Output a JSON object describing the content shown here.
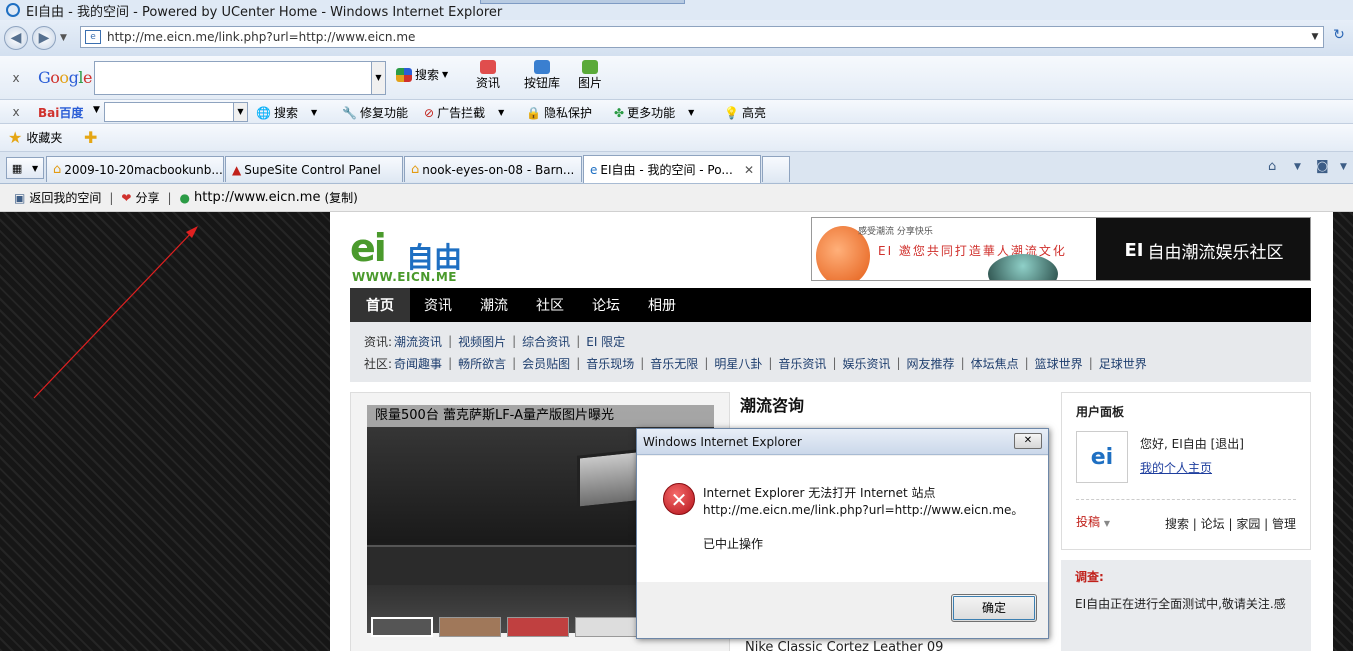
{
  "window": {
    "title": "EI自由 - 我的空间 - Powered by UCenter Home - Windows Internet Explorer"
  },
  "address_bar": {
    "url": "http://me.eicn.me/link.php?url=http://www.eicn.me"
  },
  "google_toolbar": {
    "logo": "Google",
    "search_label": "搜索",
    "news_label": "资讯",
    "buttons_label": "按钮库",
    "images_label": "图片"
  },
  "baidu_toolbar": {
    "logo_bai": "Bai",
    "logo_du": "百度",
    "search_label": "搜索",
    "repair_label": "修复功能",
    "adblock_label": "广告拦截",
    "privacy_label": "隐私保护",
    "more_label": "更多功能",
    "highlight_label": "高亮"
  },
  "favorites_bar": {
    "favorites_label": "收藏夹"
  },
  "tabs": [
    {
      "label": "2009-10-20macbookunb..."
    },
    {
      "label": "SupeSite Control Panel"
    },
    {
      "label": "nook-eyes-on-08 - Barn..."
    },
    {
      "label": "EI自由 - 我的空间 - Po..."
    }
  ],
  "command_bar": {
    "back_label": "返回我的空间",
    "share_label": "分享",
    "link_url": "http://www.eicn.me",
    "copy_label": "(复制)"
  },
  "site": {
    "logo_text": "ei",
    "logo_zh": "自由",
    "logo_url": "WWW.EICN.ME",
    "banner": {
      "tag": "感受潮流 分享快乐",
      "slogan": "EI 邀您共同打造華人潮流文化",
      "brand_ei": "EI",
      "brand_text": "自由潮流娱乐社区"
    },
    "nav": [
      "首页",
      "资讯",
      "潮流",
      "社区",
      "论坛",
      "相册"
    ],
    "subnav": {
      "news_label": "资讯:",
      "news_links": [
        "潮流资讯",
        "视频图片",
        "综合资讯",
        "EI 限定"
      ],
      "community_label": "社区:",
      "community_links": [
        "奇闻趣事",
        "畅所欲言",
        "会员贴图",
        "音乐现场",
        "音乐无限",
        "明星八卦",
        "音乐资讯",
        "娱乐资讯",
        "网友推荐",
        "体坛焦点",
        "篮球世界",
        "足球世界"
      ]
    },
    "photo_caption": "限量500台 蕾克萨斯LF-A量产版图片曝光",
    "news_title": "潮流咨询",
    "news_foot": "Nike Classic Cortez Leather 09",
    "user_panel": {
      "title": "用户面板",
      "greeting": "您好, EI自由 [退出]",
      "home_link": "我的个人主页",
      "post_label": "投稿",
      "links": "搜索 | 论坛 | 家园 | 管理"
    },
    "survey": {
      "title": "调查:",
      "text": "EI自由正在进行全面测试中,敬请关注.感"
    }
  },
  "dialog": {
    "title": "Windows Internet Explorer",
    "message_line1": "Internet Explorer 无法打开 Internet 站点",
    "message_line2": "http://me.eicn.me/link.php?url=http://www.eicn.me。",
    "message_sub": "已中止操作",
    "ok_label": "确定"
  }
}
